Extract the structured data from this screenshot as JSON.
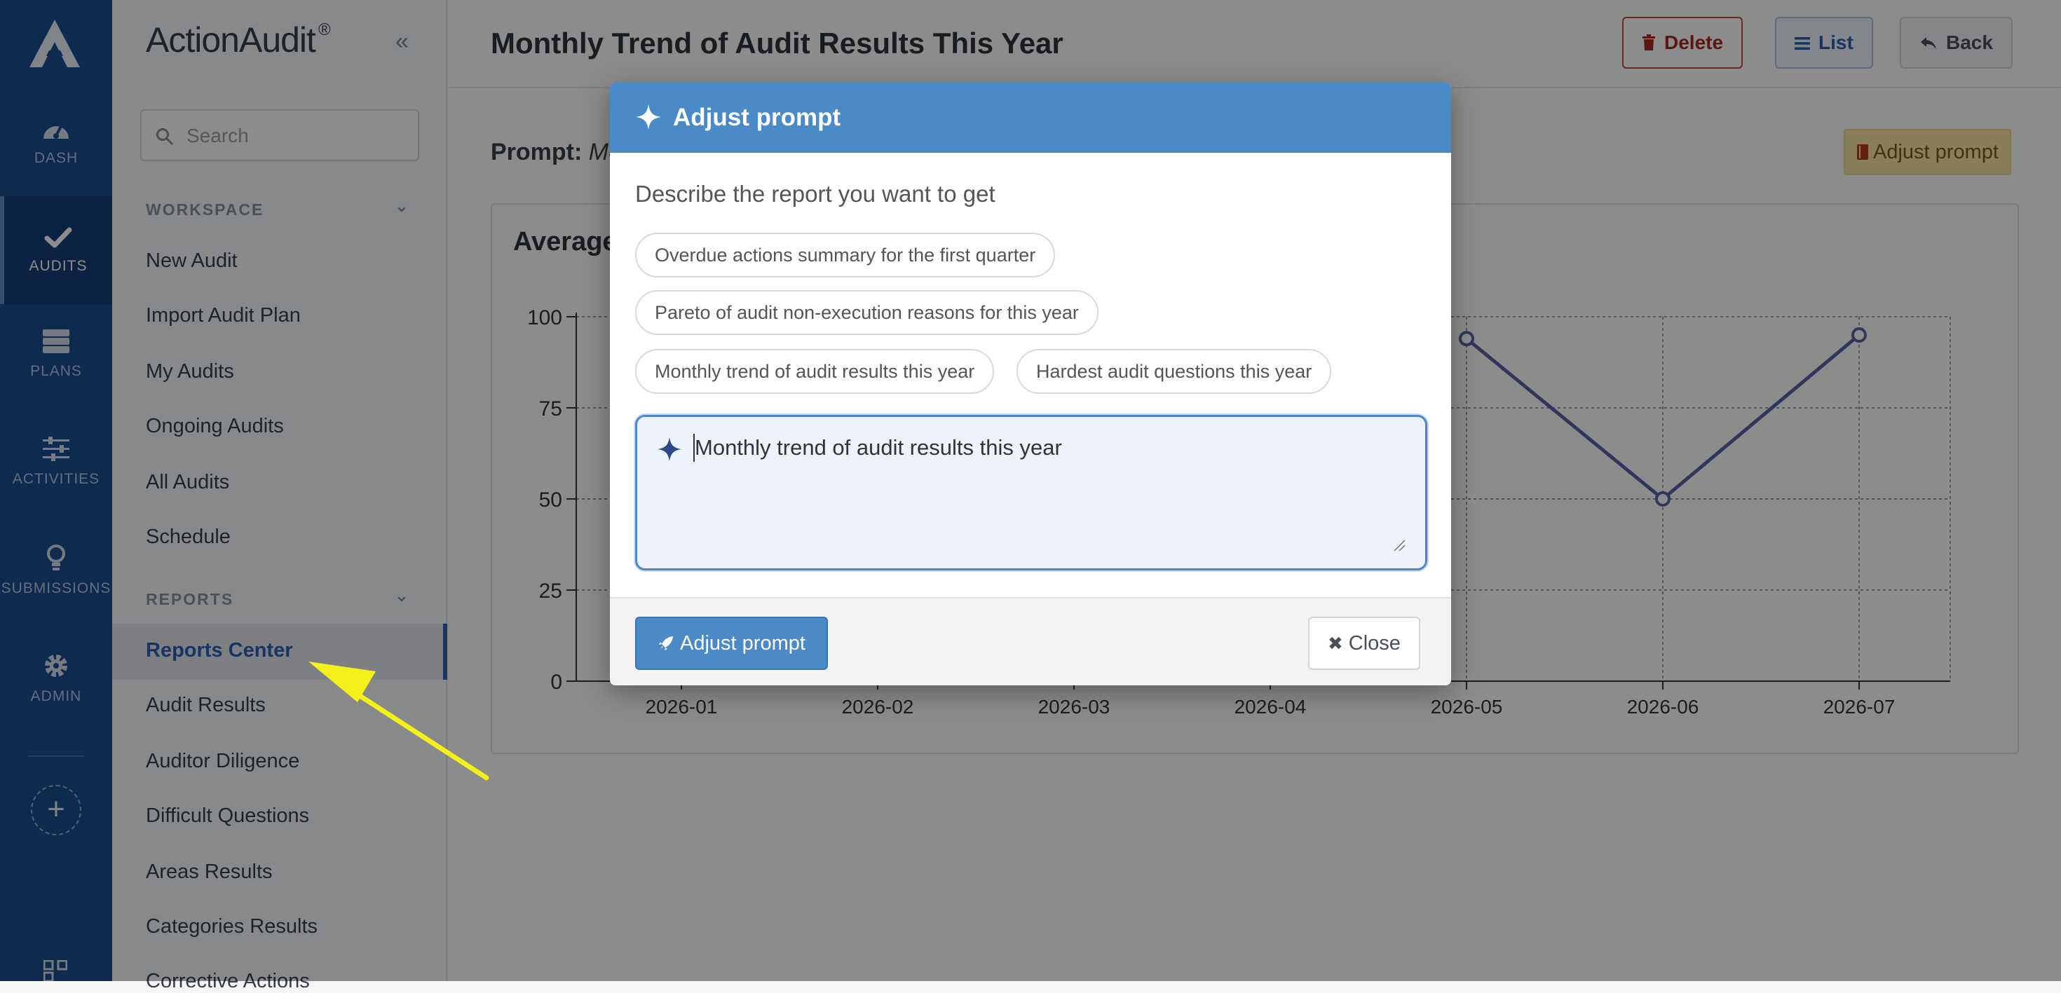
{
  "rail": {
    "items": [
      {
        "label": "DASH",
        "icon": "gauge-icon"
      },
      {
        "label": "AUDITS",
        "icon": "check-icon"
      },
      {
        "label": "PLANS",
        "icon": "server-icon"
      },
      {
        "label": "ACTIVITIES",
        "icon": "sliders-icon"
      },
      {
        "label": "SUBMISSIONS",
        "icon": "lightbulb-icon"
      },
      {
        "label": "ADMIN",
        "icon": "gear-icon"
      }
    ],
    "add_label": "+"
  },
  "sidebar": {
    "brand": "ActionAudit",
    "brand_mark": "®",
    "collapse": "«",
    "search_placeholder": "Search",
    "workspace": {
      "title": "WORKSPACE",
      "items": [
        "New Audit",
        "Import Audit Plan",
        "My Audits",
        "Ongoing Audits",
        "All Audits",
        "Schedule"
      ]
    },
    "reports": {
      "title": "REPORTS",
      "items": [
        "Reports Center",
        "Audit Results",
        "Auditor Diligence",
        "Difficult Questions",
        "Areas Results",
        "Categories Results",
        "Corrective Actions"
      ]
    }
  },
  "header": {
    "title": "Monthly Trend of Audit Results This Year",
    "delete_label": "Delete",
    "list_label": "List",
    "back_label": "Back"
  },
  "main": {
    "prompt_label": "Prompt:",
    "prompt_value": "Mo",
    "adjust_chip": "Adjust prompt",
    "card_title": "Average"
  },
  "chart_data": {
    "type": "line",
    "x": [
      "2026-01",
      "2026-02",
      "2026-03",
      "2026-04",
      "2026-05",
      "2026-06",
      "2026-07"
    ],
    "series": [
      {
        "values": [
          null,
          null,
          null,
          null,
          94,
          50,
          95
        ]
      }
    ],
    "yticks": [
      0,
      25,
      50,
      75,
      100
    ],
    "ylim": [
      0,
      100
    ],
    "grid": true,
    "color": "#5a64a8"
  },
  "modal": {
    "title": "Adjust prompt",
    "description": "Describe the report you want to get",
    "suggestions": [
      "Overdue actions summary for the first quarter",
      "Pareto of audit non-execution reasons for this year",
      "Monthly trend of audit results this year",
      "Hardest audit questions this year"
    ],
    "input_value": "Monthly trend of audit results this year",
    "submit_label": "Adjust prompt",
    "close_label": "Close"
  },
  "colors": {
    "rail": "#1a4d8f",
    "accent": "#4a8ac7",
    "danger": "#a5281c",
    "annotation_arrow": "#f4f01a"
  }
}
